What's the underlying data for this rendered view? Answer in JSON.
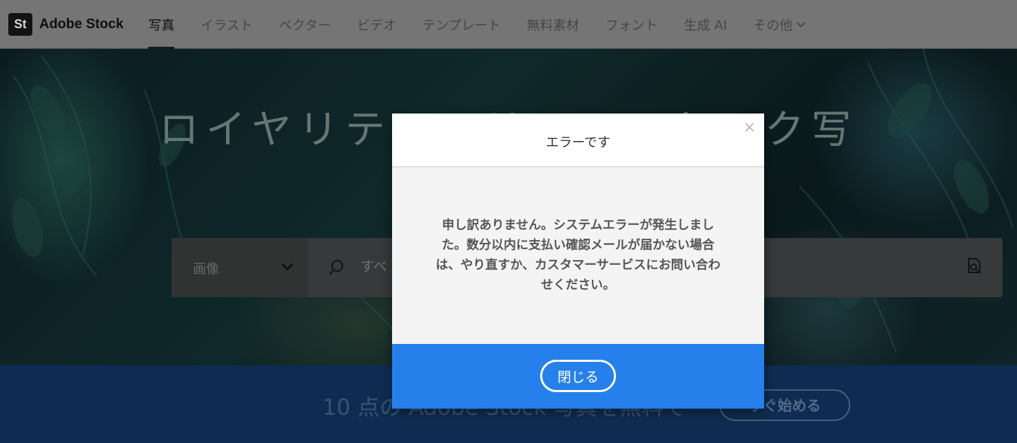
{
  "nav": {
    "logo_mark": "St",
    "logo_text": "Adobe Stock",
    "items": [
      {
        "label": "写真",
        "active": true
      },
      {
        "label": "イラスト"
      },
      {
        "label": "ベクター"
      },
      {
        "label": "ビデオ"
      },
      {
        "label": "テンプレート"
      },
      {
        "label": "無料素材"
      },
      {
        "label": "フォント"
      },
      {
        "label": "生成 AI"
      },
      {
        "label": "その他"
      }
    ]
  },
  "hero": {
    "title": "ロイヤリティフリーのストック写",
    "search": {
      "type_label": "画像",
      "placeholder": "すべ",
      "search_icon": "search-icon",
      "visual_search_icon": "visual-search-icon"
    }
  },
  "banner": {
    "text": "10 点の Adobe Stock 写真を無料で",
    "button_label": "すぐ始める"
  },
  "modal": {
    "title": "エラーです",
    "close_glyph": "×",
    "message_lines": [
      "申し訳ありません。システムエラーが発生しまし",
      "た。数分以内に支払い確認メールが届かない場合",
      "は、やり直すか、カスタマーサービスにお問い合わ",
      "せください。"
    ],
    "close_button_label": "閉じる"
  },
  "colors": {
    "accent": "#2680eb",
    "nav_bg_dimmed": "#7a7a7a",
    "banner_bg": "#0f2e55"
  }
}
